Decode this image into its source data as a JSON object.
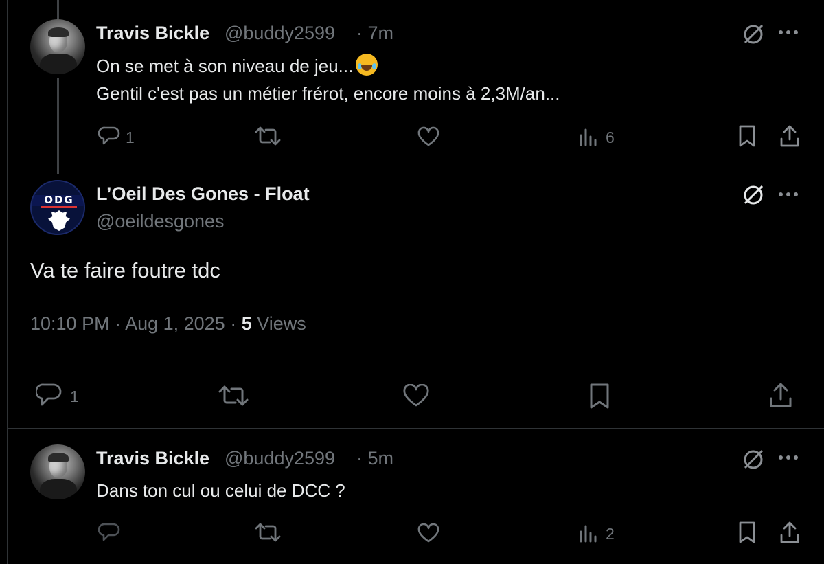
{
  "tweets": [
    {
      "name": "Travis Bickle",
      "handle": "@buddy2599",
      "time": "· 7m",
      "line1": "On se met à son niveau de jeu...",
      "line2": "Gentil c'est pas un métier frérot, encore moins à 2,3M/an...",
      "reply_count": "1",
      "views_count": "6"
    },
    {
      "name": "L’Oeil Des Gones - Float",
      "handle": "@oeildesgones",
      "text": "Va te faire foutre tdc",
      "timestamp": "10:10 PM · Aug 1, 2025 · ",
      "views_number": "5",
      "views_label": " Views",
      "reply_count": "1",
      "avatar_letters": "ODG"
    },
    {
      "name": "Travis Bickle",
      "handle": "@buddy2599",
      "time": "· 5m",
      "text": "Dans ton cul ou celui de DCC ?",
      "views_count": "2"
    }
  ],
  "icons": [
    "grok-icon",
    "more-icon",
    "reply-icon",
    "retweet-icon",
    "like-icon",
    "views-icon",
    "bookmark-icon",
    "share-icon",
    "emoji-rolling-laughing"
  ],
  "colors": {
    "background": "#000000",
    "text": "#e7e9ea",
    "muted": "#71767b",
    "divider": "#2f3336"
  }
}
